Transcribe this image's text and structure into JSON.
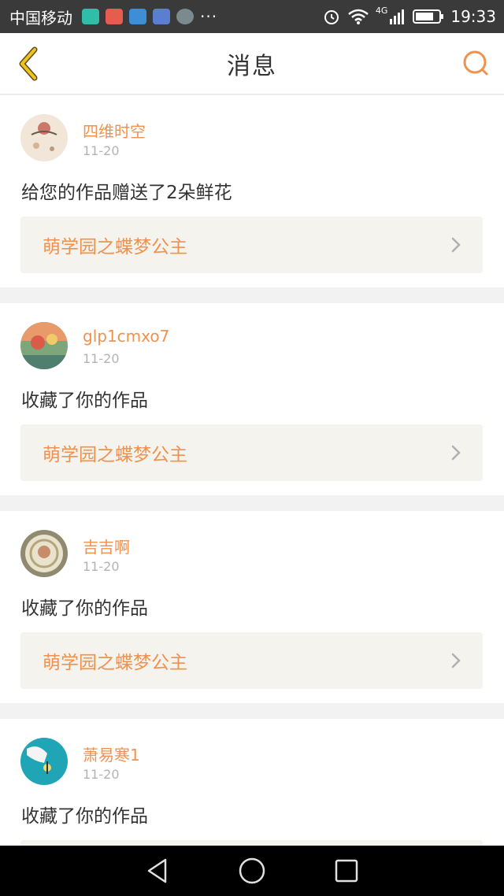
{
  "status_bar": {
    "carrier": "中国移动",
    "overflow": "···",
    "network": "4G",
    "time": "19:33"
  },
  "header": {
    "title": "消息",
    "back_icon": "chevron-left-icon",
    "search_icon": "search-icon"
  },
  "messages": [
    {
      "username": "四维时空",
      "date": "11-20",
      "action": "给您的作品赠送了2朵鲜花",
      "work_title": "萌学园之蝶梦公主"
    },
    {
      "username": "glp1cmxo7",
      "date": "11-20",
      "action": "收藏了你的作品",
      "work_title": "萌学园之蝶梦公主"
    },
    {
      "username": "吉吉啊",
      "date": "11-20",
      "action": "收藏了你的作品",
      "work_title": "萌学园之蝶梦公主"
    },
    {
      "username": "萧易寒1",
      "date": "11-20",
      "action": "收藏了你的作品",
      "work_title": ""
    }
  ],
  "colors": {
    "accent": "#f0914e",
    "back_icon": "#f0c419",
    "status_bar_bg": "#3a3a3a",
    "card_link_bg": "#f4f3ee"
  }
}
